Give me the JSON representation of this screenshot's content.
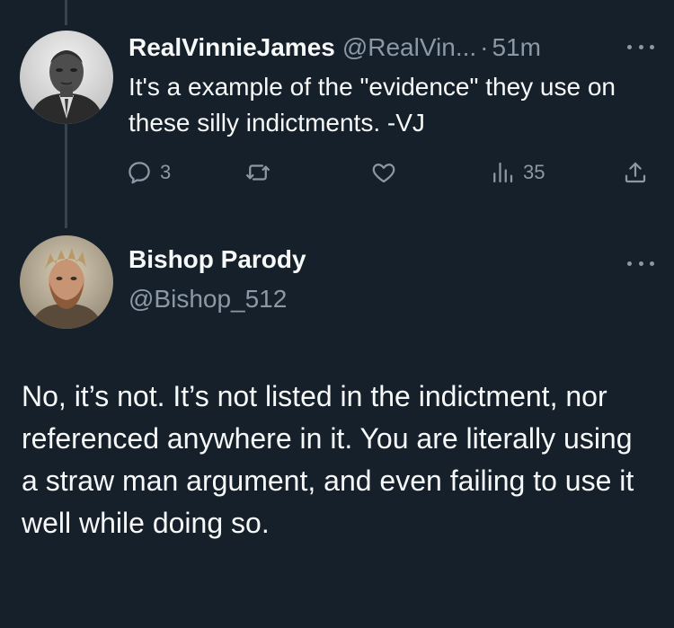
{
  "reply_tweet": {
    "author": {
      "display_name": "RealVinnieJames",
      "handle": "@RealVin...",
      "time": "51m"
    },
    "text": "It's a example of the \"evidence\" they use on these silly indictments. -VJ",
    "actions": {
      "reply_count": "3",
      "retweet_count": "",
      "like_count": "",
      "view_count": "35"
    },
    "icons": [
      "reply-icon",
      "retweet-icon",
      "like-icon",
      "views-icon",
      "share-icon",
      "more-icon"
    ]
  },
  "main_tweet": {
    "author": {
      "display_name": "Bishop Parody",
      "handle": "@Bishop_512"
    },
    "text": "No, it’s not. It’s not listed in the indictment, nor referenced anywhere in it. You are literally using a straw man argument, and even failing to use it well while doing so."
  },
  "colors": {
    "background": "#15202b",
    "text_primary": "#f7f9f9",
    "text_secondary": "#8b98a5",
    "thread_line": "#38444d"
  }
}
